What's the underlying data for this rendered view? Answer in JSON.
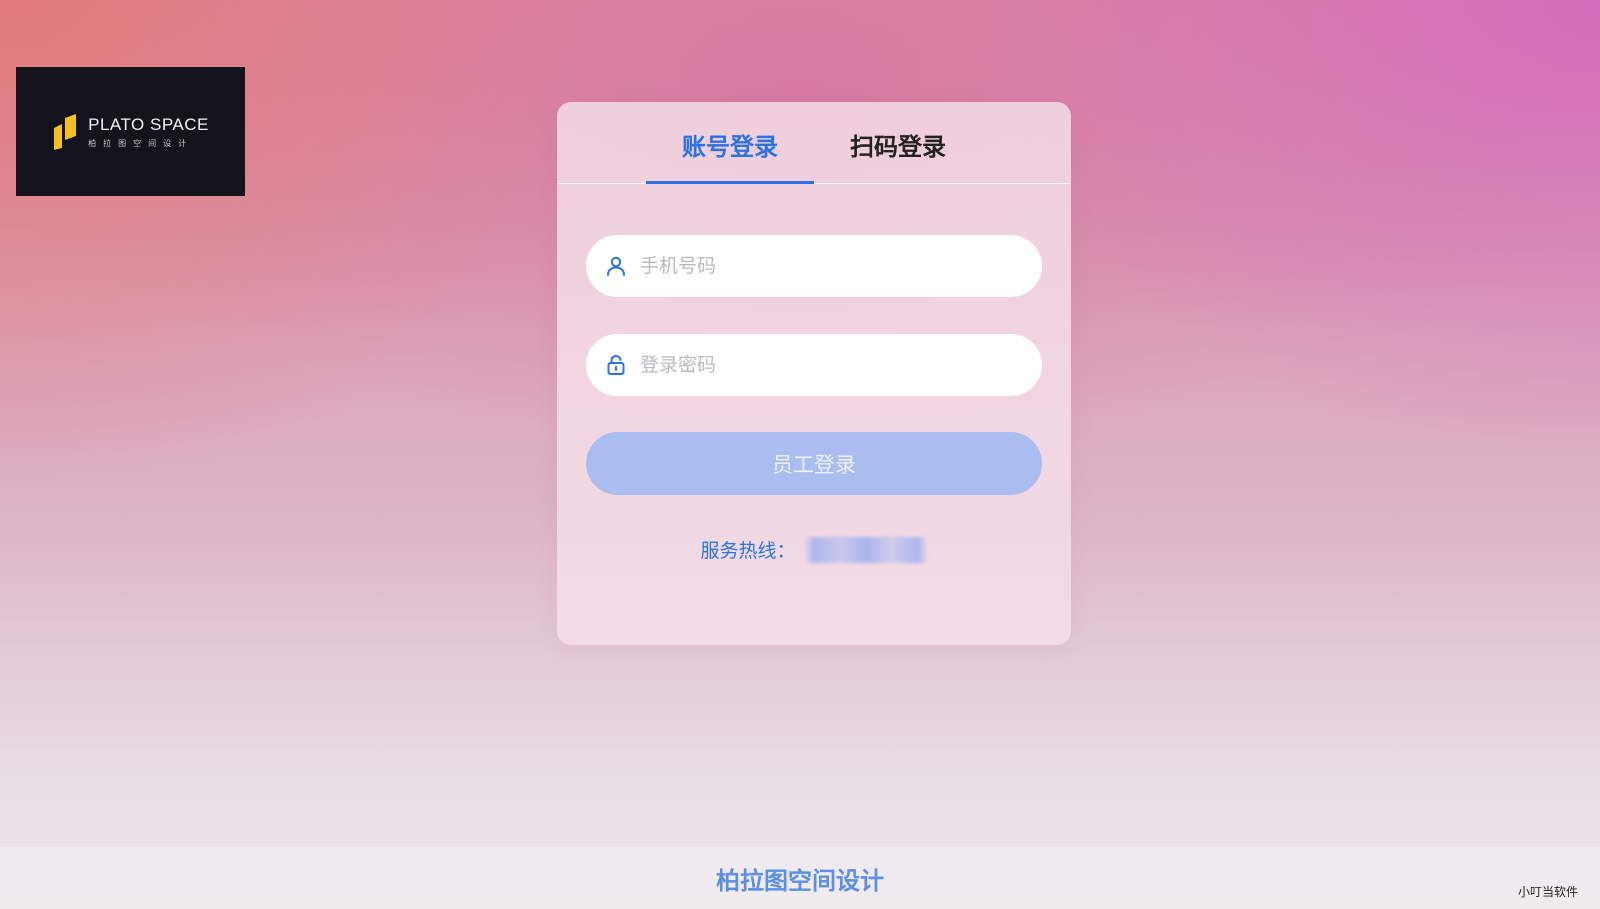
{
  "logo": {
    "name": "PLATO SPACE",
    "subtitle": "柏拉图空间设计"
  },
  "tabs": [
    {
      "label": "账号登录",
      "active": true
    },
    {
      "label": "扫码登录",
      "active": false
    }
  ],
  "form": {
    "phone_placeholder": "手机号码",
    "password_placeholder": "登录密码",
    "submit_label": "员工登录"
  },
  "hotline": {
    "label": "服务热线："
  },
  "footer": {
    "title": "柏拉图空间设计"
  },
  "watermark": "小叮当软件",
  "colors": {
    "accent": "#2a72e6",
    "button_disabled": "#a9bdf0",
    "logo_mark": "#f4c21a",
    "logo_bg": "#14121a"
  },
  "icons": {
    "phone_field": "user-icon",
    "password_field": "lock-icon"
  }
}
